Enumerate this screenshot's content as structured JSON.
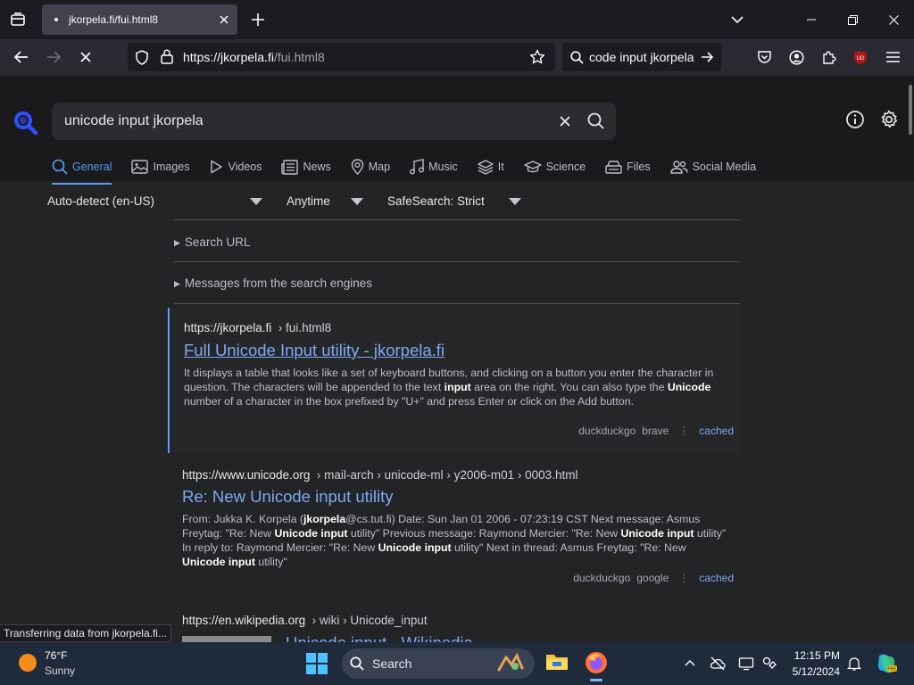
{
  "browser": {
    "tab_title": "jkorpela.fi/fui.html8",
    "url_host": "https://jkorpela.fi",
    "url_path": "/fui.html8",
    "search_bar_text": "code input jkorpela",
    "status_text": "Transferring data from jkorpela.fi..."
  },
  "searx": {
    "query": "unicode input jkorpela",
    "categories": [
      {
        "label": "General",
        "icon": "search-icon",
        "active": true
      },
      {
        "label": "Images",
        "icon": "image-icon"
      },
      {
        "label": "Videos",
        "icon": "play-icon"
      },
      {
        "label": "News",
        "icon": "newspaper-icon"
      },
      {
        "label": "Map",
        "icon": "map-pin-icon"
      },
      {
        "label": "Music",
        "icon": "music-note-icon"
      },
      {
        "label": "It",
        "icon": "layers-icon"
      },
      {
        "label": "Science",
        "icon": "graduation-cap-icon"
      },
      {
        "label": "Files",
        "icon": "drive-icon"
      },
      {
        "label": "Social Media",
        "icon": "people-icon"
      }
    ],
    "filters": {
      "language": "Auto-detect (en-US)",
      "time": "Anytime",
      "safesearch": "SafeSearch: Strict"
    },
    "search_url_label": "Search URL",
    "messages_label": "Messages from the search engines",
    "results": [
      {
        "host": "https://jkorpela.fi",
        "path": "› fui.html8",
        "title": "Full Unicode Input utility - jkorpela.fi",
        "engines": [
          "duckduckgo",
          "brave"
        ],
        "cached": "cached"
      },
      {
        "host": "https://www.unicode.org",
        "path": "› mail-arch › unicode-ml › y2006-m01 › 0003.html",
        "title": "Re: New Unicode input utility",
        "engines": [
          "duckduckgo",
          "google"
        ],
        "cached": "cached"
      },
      {
        "host": "https://en.wikipedia.org",
        "path": "› wiki › Unicode_input",
        "title": "Unicode input - Wikipedia"
      }
    ]
  },
  "taskbar": {
    "temperature": "76°F",
    "condition": "Sunny",
    "search_label": "Search",
    "time": "12:15 PM",
    "date": "5/12/2024"
  },
  "colors": {
    "accent": "#5b9cf2",
    "link": "#7ea9f5",
    "page_bg": "#222426"
  }
}
